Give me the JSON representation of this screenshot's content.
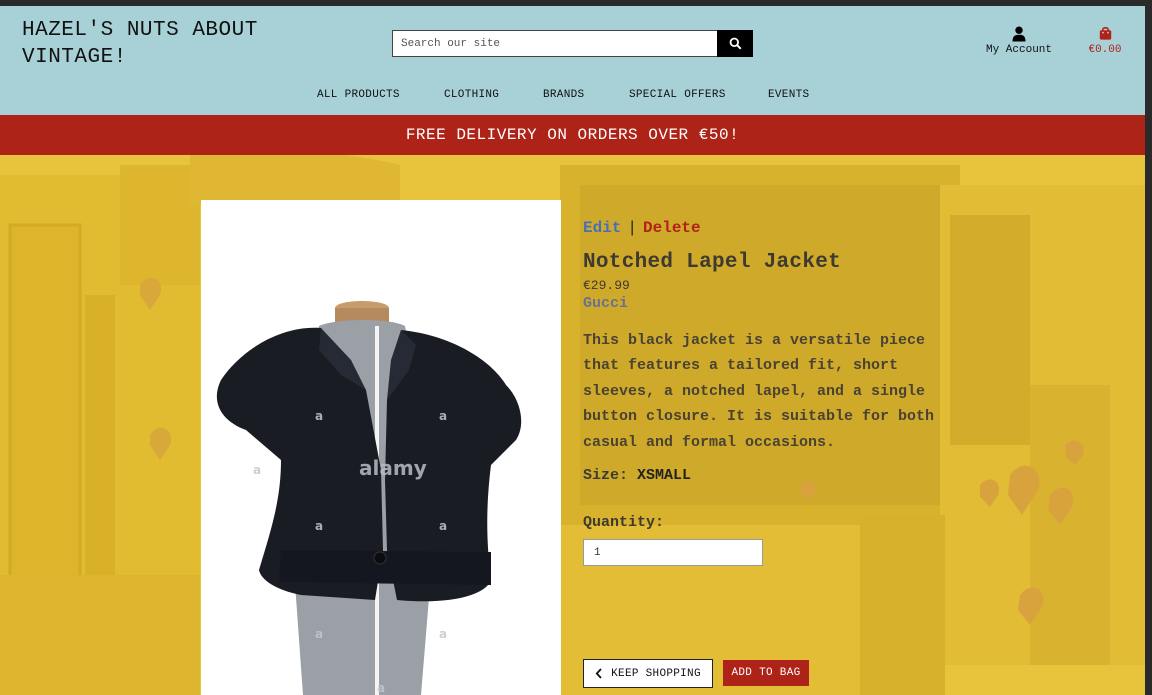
{
  "header": {
    "logo_line1": "HAZEL'S NUTS ABOUT",
    "logo_line2": "VINTAGE!",
    "search_placeholder": "Search our site",
    "account_label": "My Account",
    "bag_total": "€0.00"
  },
  "nav": {
    "items": [
      {
        "label": "ALL PRODUCTS"
      },
      {
        "label": "CLOTHING"
      },
      {
        "label": "BRANDS"
      },
      {
        "label": "SPECIAL OFFERS"
      },
      {
        "label": "EVENTS"
      }
    ]
  },
  "banner": {
    "text": "FREE DELIVERY ON ORDERS OVER €50!"
  },
  "product": {
    "edit_label": "Edit",
    "separator": "|",
    "delete_label": "Delete",
    "name": "Notched Lapel Jacket",
    "price": "€29.99",
    "brand": "Gucci",
    "description": "This black jacket is a versatile piece that features a tailored fit, short sleeves, a notched lapel, and a single button closure. It is suitable for both casual and formal occasions.",
    "size_label": "Size:",
    "size_value": "XSMALL",
    "quantity_label": "Quantity:",
    "quantity_value": "1",
    "image_watermark": "alamy",
    "watermark_mark": "a"
  },
  "actions": {
    "keep_shopping_label": "KEEP SHOPPING",
    "add_to_bag_label": "ADD TO BAG"
  },
  "colors": {
    "header_bg": "#a7d1d6",
    "banner_bg": "#ad2318",
    "page_bg": "#e6c23a",
    "edit_link": "#4a6fb8",
    "delete_link": "#b02418"
  }
}
